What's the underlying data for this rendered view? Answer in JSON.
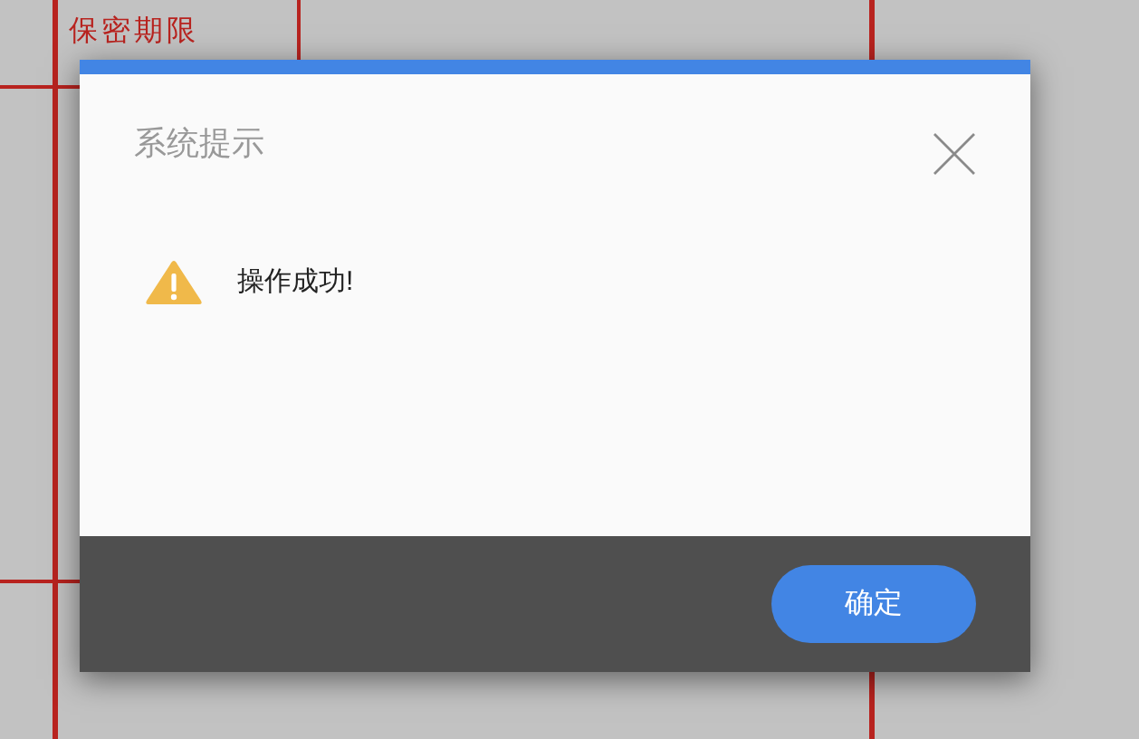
{
  "form": {
    "field_label": "保密期限"
  },
  "dialog": {
    "title": "系统提示",
    "message": "操作成功!",
    "buttons": [
      "确定"
    ]
  }
}
